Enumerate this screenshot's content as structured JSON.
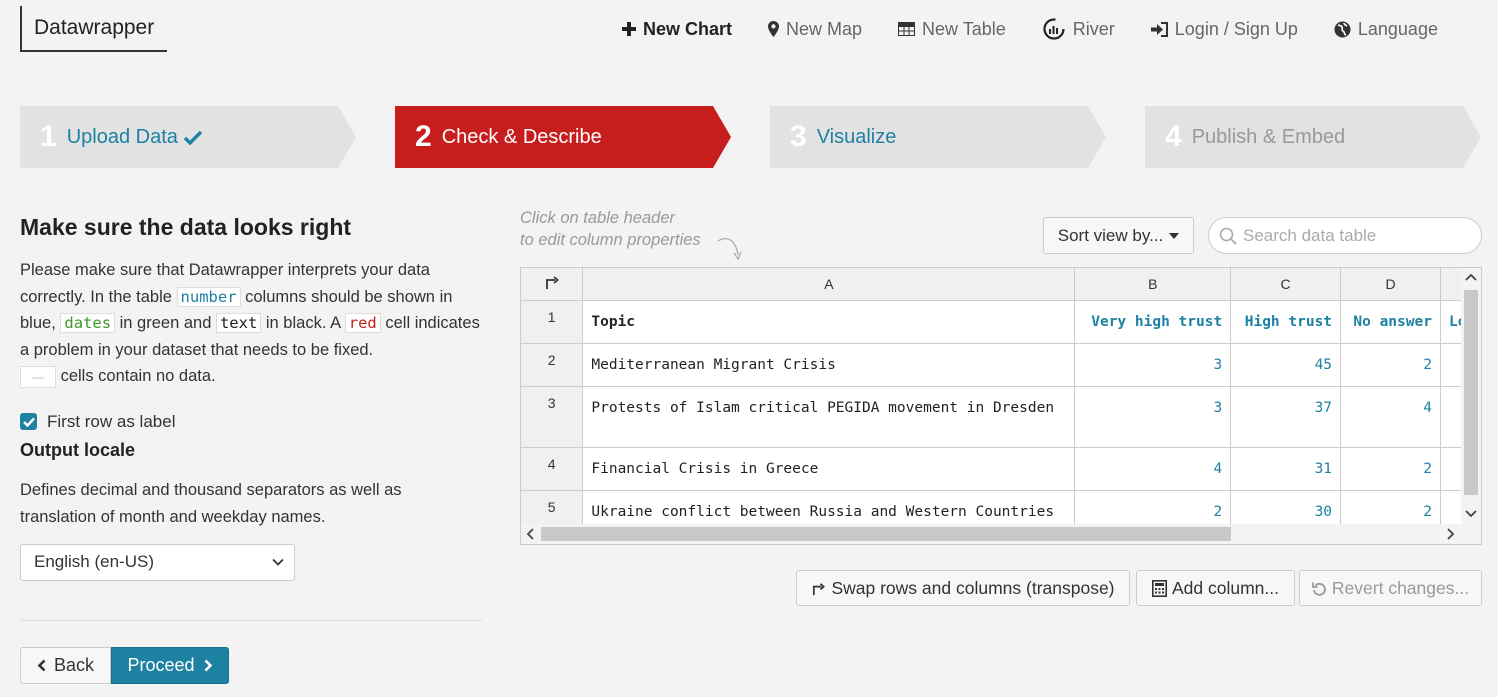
{
  "brand": "Datawrapper",
  "nav": {
    "new_chart": "New Chart",
    "new_map": "New Map",
    "new_table": "New Table",
    "river": "River",
    "login": "Login / Sign Up",
    "language": "Language"
  },
  "steps": [
    {
      "num": "1",
      "label": "Upload Data",
      "state": "done"
    },
    {
      "num": "2",
      "label": "Check & Describe",
      "state": "active"
    },
    {
      "num": "3",
      "label": "Visualize",
      "state": "todo"
    },
    {
      "num": "4",
      "label": "Publish & Embed",
      "state": "disabled"
    }
  ],
  "left": {
    "title": "Make sure the data looks right",
    "desc_1": "Please make sure that Datawrapper interprets your data correctly. In the table ",
    "code_number": "number",
    "desc_2": " columns should be shown in blue, ",
    "code_dates": "dates",
    "desc_3": " in green and ",
    "code_text": "text",
    "desc_4": " in black. A ",
    "code_red": "red",
    "desc_5": " cell indicates a problem in your dataset that needs to be fixed.",
    "empty_marker": "—",
    "desc_6": " cells contain no data.",
    "first_row_label": "First row as label",
    "output_locale_title": "Output locale",
    "output_locale_desc": "Defines decimal and thousand separators as well as translation of month and weekday names.",
    "locale_value": "English (en-US)"
  },
  "buttons": {
    "back": "Back",
    "proceed": "Proceed",
    "transpose": "Swap rows and columns (transpose)",
    "add_column": "Add column...",
    "revert": "Revert changes..."
  },
  "table_area": {
    "hint_1": "Click on table header",
    "hint_2": "to edit column properties",
    "sort_label": "Sort view by...",
    "search_placeholder": "Search data table"
  },
  "grid": {
    "col_headers": [
      "A",
      "B",
      "C",
      "D"
    ],
    "rows": [
      {
        "n": "1",
        "a": "Topic",
        "b": "Very high trust",
        "c": "High trust",
        "d": "No answer",
        "e": "Lo"
      },
      {
        "n": "2",
        "a": "Mediterranean Migrant Crisis",
        "b": "3",
        "c": "45",
        "d": "2"
      },
      {
        "n": "3",
        "a": "Protests of Islam critical PEGIDA movement in Dresden",
        "b": "3",
        "c": "37",
        "d": "4"
      },
      {
        "n": "4",
        "a": "Financial Crisis in Greece",
        "b": "4",
        "c": "31",
        "d": "2"
      },
      {
        "n": "5",
        "a": "Ukraine conflict between Russia and Western Countries",
        "b": "2",
        "c": "30",
        "d": "2"
      }
    ]
  },
  "colors": {
    "accent": "#1d81a2",
    "active_step": "#c71e1d",
    "date_green": "#3c9a2c"
  }
}
